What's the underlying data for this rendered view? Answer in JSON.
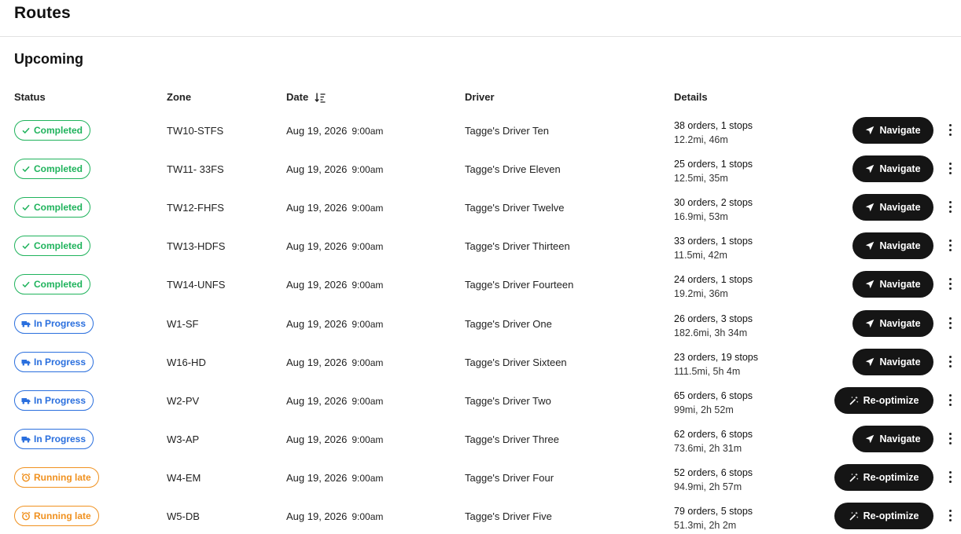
{
  "page": {
    "title": "Routes"
  },
  "section": {
    "title": "Upcoming"
  },
  "columns": {
    "status": "Status",
    "zone": "Zone",
    "date": "Date",
    "driver": "Driver",
    "details": "Details"
  },
  "colors": {
    "completed": "#1fb35c",
    "in_progress": "#2a6fde",
    "running_late": "#f0911f",
    "button_bg": "#151515"
  },
  "routes": [
    {
      "status": "Completed",
      "status_type": "completed",
      "zone": "TW10-STFS",
      "date": "Aug 19, 2026",
      "time": "9:00am",
      "driver": "Tagge's Driver Ten",
      "orders": "38 orders, 1 stops",
      "distance": "12.2mi, 46m",
      "action": "Navigate",
      "action_type": "nav"
    },
    {
      "status": "Completed",
      "status_type": "completed",
      "zone": "TW11- 33FS",
      "date": "Aug 19, 2026",
      "time": "9:00am",
      "driver": "Tagge's Drive Eleven",
      "orders": "25 orders, 1 stops",
      "distance": "12.5mi, 35m",
      "action": "Navigate",
      "action_type": "nav"
    },
    {
      "status": "Completed",
      "status_type": "completed",
      "zone": "TW12-FHFS",
      "date": "Aug 19, 2026",
      "time": "9:00am",
      "driver": "Tagge's Driver Twelve",
      "orders": "30 orders, 2 stops",
      "distance": "16.9mi, 53m",
      "action": "Navigate",
      "action_type": "nav"
    },
    {
      "status": "Completed",
      "status_type": "completed",
      "zone": "TW13-HDFS",
      "date": "Aug 19, 2026",
      "time": "9:00am",
      "driver": "Tagge's Driver Thirteen",
      "orders": "33 orders, 1 stops",
      "distance": "11.5mi, 42m",
      "action": "Navigate",
      "action_type": "nav"
    },
    {
      "status": "Completed",
      "status_type": "completed",
      "zone": "TW14-UNFS",
      "date": "Aug 19, 2026",
      "time": "9:00am",
      "driver": "Tagge's Driver Fourteen",
      "orders": "24 orders, 1 stops",
      "distance": "19.2mi, 36m",
      "action": "Navigate",
      "action_type": "nav"
    },
    {
      "status": "In Progress",
      "status_type": "progress",
      "zone": "W1-SF",
      "date": "Aug 19, 2026",
      "time": "9:00am",
      "driver": "Tagge's Driver One",
      "orders": "26 orders, 3 stops",
      "distance": "182.6mi, 3h 34m",
      "action": "Navigate",
      "action_type": "nav"
    },
    {
      "status": "In Progress",
      "status_type": "progress",
      "zone": "W16-HD",
      "date": "Aug 19, 2026",
      "time": "9:00am",
      "driver": "Tagge's Driver Sixteen",
      "orders": "23 orders, 19 stops",
      "distance": "111.5mi, 5h 4m",
      "action": "Navigate",
      "action_type": "nav"
    },
    {
      "status": "In Progress",
      "status_type": "progress",
      "zone": "W2-PV",
      "date": "Aug 19, 2026",
      "time": "9:00am",
      "driver": "Tagge's Driver Two",
      "orders": "65 orders, 6 stops",
      "distance": "99mi, 2h 52m",
      "action": "Re-optimize",
      "action_type": "reopt"
    },
    {
      "status": "In Progress",
      "status_type": "progress",
      "zone": "W3-AP",
      "date": "Aug 19, 2026",
      "time": "9:00am",
      "driver": "Tagge's Driver Three",
      "orders": "62 orders, 6 stops",
      "distance": "73.6mi, 2h 31m",
      "action": "Navigate",
      "action_type": "nav"
    },
    {
      "status": "Running late",
      "status_type": "late",
      "zone": "W4-EM",
      "date": "Aug 19, 2026",
      "time": "9:00am",
      "driver": "Tagge's Driver Four",
      "orders": "52 orders, 6 stops",
      "distance": "94.9mi, 2h 57m",
      "action": "Re-optimize",
      "action_type": "reopt"
    },
    {
      "status": "Running late",
      "status_type": "late",
      "zone": "W5-DB",
      "date": "Aug 19, 2026",
      "time": "9:00am",
      "driver": "Tagge's Driver Five",
      "orders": "79 orders, 5 stops",
      "distance": "51.3mi, 2h 2m",
      "action": "Re-optimize",
      "action_type": "reopt"
    }
  ]
}
